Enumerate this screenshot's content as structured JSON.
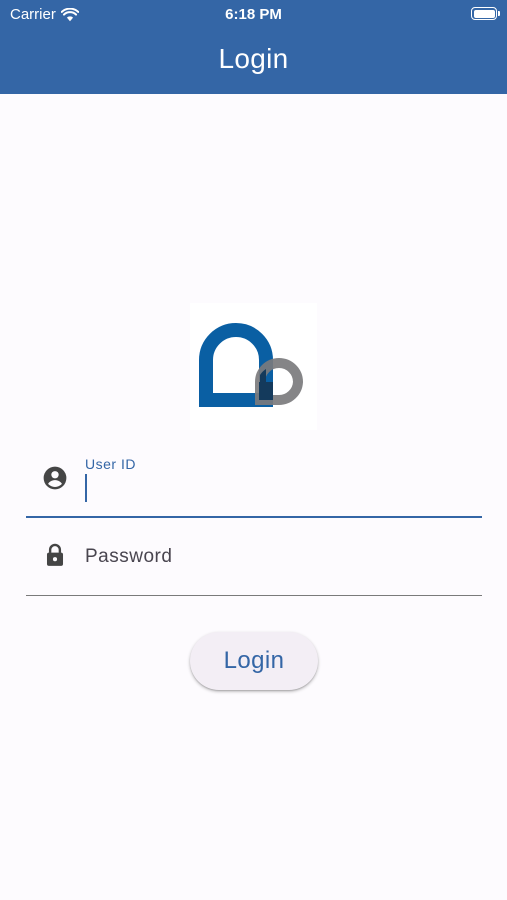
{
  "status_bar": {
    "carrier": "Carrier",
    "time": "6:18 PM",
    "icons": {
      "wifi": "wifi-icon",
      "battery": "battery-icon"
    }
  },
  "app_bar": {
    "title": "Login"
  },
  "logo": {
    "name": "app-logo",
    "colors": {
      "primary": "#0a5fa3",
      "secondary": "#7b7b7d"
    }
  },
  "form": {
    "user_id": {
      "label": "User ID",
      "value": "",
      "icon": "account-circle-icon"
    },
    "password": {
      "placeholder": "Password",
      "value": "",
      "icon": "lock-icon"
    },
    "submit_label": "Login"
  },
  "colors": {
    "app_bar": "#3466a6",
    "background": "#fdfbfe",
    "accent": "#3466a6",
    "button_bg": "#f3eef5"
  }
}
